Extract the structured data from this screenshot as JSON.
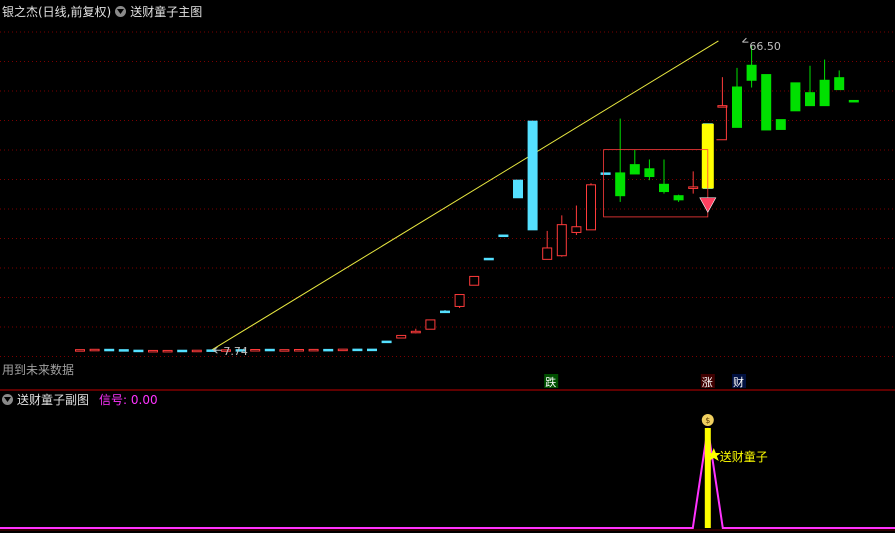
{
  "header": {
    "stock_title": "银之杰(日线,前复权)",
    "main_indicator": "送财童子主图",
    "sub_indicator": "送财童子副图",
    "signal_label": "信号: 0.00"
  },
  "colors": {
    "background": "#000000",
    "grid": "#7a0000",
    "up": "#ff3b3b",
    "down": "#00e000",
    "flat": "#55e0ff",
    "trend_line": "#e8e840",
    "signal_line": "#ff33ff",
    "signal_bar": "#ffff00",
    "label_die": "#00c000",
    "label_zhang": "#ff4040",
    "label_cai": "#3a8cff"
  },
  "chart_data": {
    "type": "candlestick",
    "y_range": [
      4.5,
      70
    ],
    "annotations": {
      "high_label": "66.50",
      "high_value": 66.5,
      "low_label": "7.74",
      "low_value": 7.74,
      "future_data_label": "用到未来数据",
      "marker_die": "跌",
      "marker_zhang": "涨",
      "marker_cai": "财",
      "sub_marker_label": "送财童子"
    },
    "candles": [
      {
        "o": 7.85,
        "h": 7.85,
        "l": 7.85,
        "c": 7.85,
        "k": "up"
      },
      {
        "o": 7.92,
        "h": 7.92,
        "l": 7.92,
        "c": 7.92,
        "k": "up"
      },
      {
        "o": 7.92,
        "h": 7.92,
        "l": 7.92,
        "c": 7.92,
        "k": "flat"
      },
      {
        "o": 7.85,
        "h": 7.85,
        "l": 7.85,
        "c": 7.85,
        "k": "flat"
      },
      {
        "o": 7.75,
        "h": 7.75,
        "l": 7.75,
        "c": 7.75,
        "k": "flat"
      },
      {
        "o": 7.7,
        "h": 7.7,
        "l": 7.7,
        "c": 7.7,
        "k": "up"
      },
      {
        "o": 7.7,
        "h": 7.7,
        "l": 7.7,
        "c": 7.7,
        "k": "up"
      },
      {
        "o": 7.74,
        "h": 7.74,
        "l": 7.74,
        "c": 7.74,
        "k": "flat"
      },
      {
        "o": 7.74,
        "h": 7.74,
        "l": 7.74,
        "c": 7.74,
        "k": "up"
      },
      {
        "o": 7.8,
        "h": 7.8,
        "l": 7.8,
        "c": 7.8,
        "k": "flat"
      },
      {
        "o": 7.82,
        "h": 7.82,
        "l": 7.82,
        "c": 7.82,
        "k": "up"
      },
      {
        "o": 7.85,
        "h": 7.85,
        "l": 7.85,
        "c": 7.85,
        "k": "flat"
      },
      {
        "o": 7.88,
        "h": 7.88,
        "l": 7.88,
        "c": 7.88,
        "k": "up"
      },
      {
        "o": 7.92,
        "h": 7.92,
        "l": 7.92,
        "c": 7.92,
        "k": "flat"
      },
      {
        "o": 7.85,
        "h": 7.85,
        "l": 7.85,
        "c": 7.85,
        "k": "up"
      },
      {
        "o": 7.88,
        "h": 7.88,
        "l": 7.88,
        "c": 7.88,
        "k": "up"
      },
      {
        "o": 7.9,
        "h": 7.9,
        "l": 7.9,
        "c": 7.9,
        "k": "up"
      },
      {
        "o": 7.9,
        "h": 7.9,
        "l": 7.9,
        "c": 7.9,
        "k": "flat"
      },
      {
        "o": 7.95,
        "h": 7.95,
        "l": 7.95,
        "c": 7.95,
        "k": "up"
      },
      {
        "o": 7.95,
        "h": 7.95,
        "l": 7.95,
        "c": 7.95,
        "k": "flat"
      },
      {
        "o": 7.95,
        "h": 7.95,
        "l": 7.95,
        "c": 7.95,
        "k": "flat"
      },
      {
        "o": 9.5,
        "h": 9.5,
        "l": 9.5,
        "c": 9.5,
        "k": "flat"
      },
      {
        "o": 10.1,
        "h": 10.6,
        "l": 10.1,
        "c": 10.6,
        "k": "up"
      },
      {
        "o": 11.2,
        "h": 11.9,
        "l": 11.0,
        "c": 11.4,
        "k": "up"
      },
      {
        "o": 11.8,
        "h": 13.6,
        "l": 11.8,
        "c": 13.6,
        "k": "up"
      },
      {
        "o": 15.3,
        "h": 15.5,
        "l": 15.1,
        "c": 15.3,
        "k": "flat"
      },
      {
        "o": 16.2,
        "h": 18.5,
        "l": 15.9,
        "c": 18.5,
        "k": "up"
      },
      {
        "o": 20.3,
        "h": 22.0,
        "l": 20.3,
        "c": 22.0,
        "k": "up"
      },
      {
        "o": 25.5,
        "h": 25.5,
        "l": 25.5,
        "c": 25.5,
        "k": "flat"
      },
      {
        "o": 30.0,
        "h": 30.0,
        "l": 30.0,
        "c": 30.0,
        "k": "flat"
      },
      {
        "o": 37.2,
        "h": 40.6,
        "l": 37.2,
        "c": 40.6,
        "k": "flat"
      },
      {
        "o": 31.0,
        "h": 52.0,
        "l": 31.0,
        "c": 52.0,
        "k": "flat"
      },
      {
        "o": 25.3,
        "h": 30.8,
        "l": 25.3,
        "c": 27.5,
        "k": "up"
      },
      {
        "o": 26.0,
        "h": 33.8,
        "l": 25.8,
        "c": 32.0,
        "k": "up"
      },
      {
        "o": 30.5,
        "h": 35.7,
        "l": 30.0,
        "c": 31.6,
        "k": "up"
      },
      {
        "o": 31.0,
        "h": 40.0,
        "l": 31.0,
        "c": 39.7,
        "k": "up"
      },
      {
        "o": 42.0,
        "h": 42.0,
        "l": 42.0,
        "c": 42.0,
        "k": "flat"
      },
      {
        "o": 42.0,
        "h": 52.5,
        "l": 36.4,
        "c": 37.6,
        "k": "down"
      },
      {
        "o": 43.6,
        "h": 46.5,
        "l": 41.8,
        "c": 41.8,
        "k": "down"
      },
      {
        "o": 42.8,
        "h": 44.6,
        "l": 40.6,
        "c": 41.3,
        "k": "down"
      },
      {
        "o": 39.8,
        "h": 44.6,
        "l": 38.0,
        "c": 38.4,
        "k": "down"
      },
      {
        "o": 37.6,
        "h": 37.8,
        "l": 36.4,
        "c": 36.8,
        "k": "down"
      },
      {
        "o": 39.0,
        "h": 42.3,
        "l": 38.0,
        "c": 39.3,
        "k": "up"
      },
      {
        "o": 39.0,
        "h": 51.5,
        "l": 39.0,
        "c": 51.5,
        "k": "flat"
      },
      {
        "o": 55.0,
        "h": 60.5,
        "l": 55.0,
        "c": 55.0,
        "k": "up"
      },
      {
        "o": 50.8,
        "h": 62.3,
        "l": 50.8,
        "c": 58.6,
        "k": "down"
      },
      {
        "o": 59.9,
        "h": 66.5,
        "l": 58.5,
        "c": 62.8,
        "k": "down"
      },
      {
        "o": 61.0,
        "h": 61.0,
        "l": 50.3,
        "c": 50.3,
        "k": "down"
      },
      {
        "o": 52.3,
        "h": 52.3,
        "l": 50.4,
        "c": 50.4,
        "k": "down"
      },
      {
        "o": 59.4,
        "h": 59.4,
        "l": 54.0,
        "c": 54.0,
        "k": "down"
      },
      {
        "o": 57.5,
        "h": 62.7,
        "l": 55.0,
        "c": 55.0,
        "k": "down"
      },
      {
        "o": 59.9,
        "h": 63.9,
        "l": 55.0,
        "c": 55.0,
        "k": "down"
      },
      {
        "o": 60.4,
        "h": 61.8,
        "l": 58.1,
        "c": 58.1,
        "k": "down"
      },
      {
        "o": 56.0,
        "h": 56.0,
        "l": 56.0,
        "c": 56.0,
        "k": "down"
      }
    ],
    "signal": {
      "value": 0.0,
      "peak_index": 43
    }
  }
}
